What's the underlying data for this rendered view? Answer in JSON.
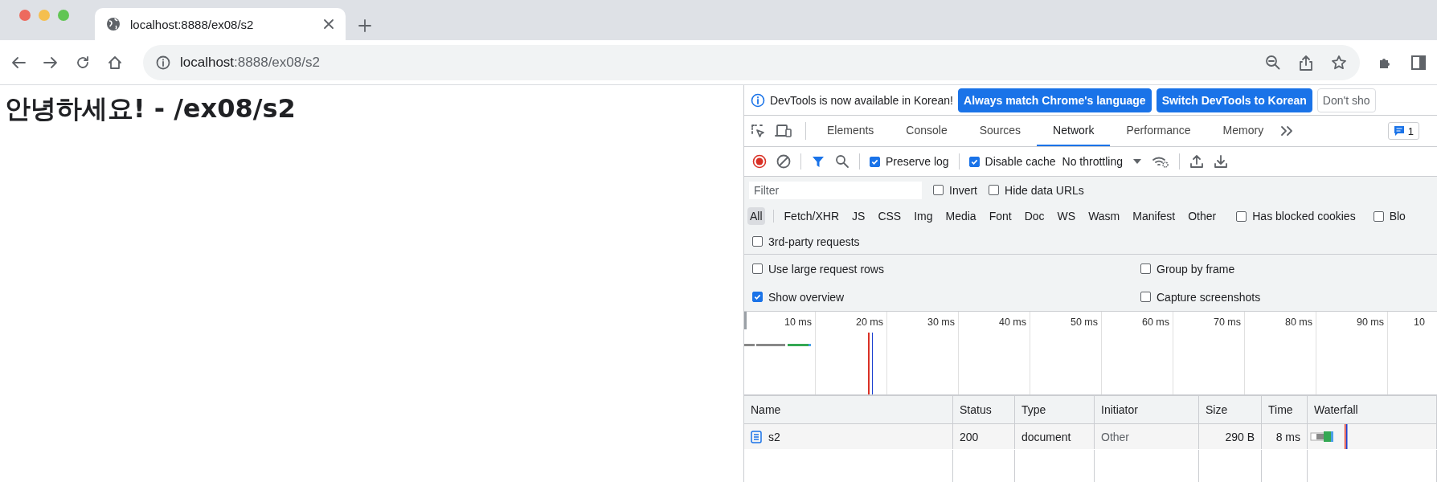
{
  "browser": {
    "tab": {
      "title": "localhost:8888/ex08/s2"
    },
    "address": {
      "host": "localhost",
      "path": ":8888/ex08/s2"
    }
  },
  "page": {
    "heading": "안녕하세요! - /ex08/s2"
  },
  "devtools": {
    "infobar": {
      "message": "DevTools is now available in Korean!",
      "buttons": [
        {
          "label": "Always match Chrome's language",
          "kind": "primary"
        },
        {
          "label": "Switch DevTools to Korean",
          "kind": "primary"
        },
        {
          "label": "Don't sho",
          "kind": "plain"
        }
      ]
    },
    "tabs": [
      {
        "label": "Elements",
        "selected": false
      },
      {
        "label": "Console",
        "selected": false
      },
      {
        "label": "Sources",
        "selected": false
      },
      {
        "label": "Network",
        "selected": true
      },
      {
        "label": "Performance",
        "selected": false
      },
      {
        "label": "Memory",
        "selected": false
      }
    ],
    "issues_badge": "1",
    "toolbar": {
      "checks": [
        {
          "label": "Preserve log",
          "checked": true
        },
        {
          "label": "Disable cache",
          "checked": true
        }
      ],
      "throttling": "No throttling"
    },
    "filter": {
      "placeholder": "Filter",
      "checks": [
        {
          "label": "Invert",
          "checked": false
        },
        {
          "label": "Hide data URLs",
          "checked": false
        }
      ]
    },
    "types": [
      {
        "label": "All",
        "selected": true
      },
      {
        "label": "Fetch/XHR",
        "selected": false
      },
      {
        "label": "JS",
        "selected": false
      },
      {
        "label": "CSS",
        "selected": false
      },
      {
        "label": "Img",
        "selected": false
      },
      {
        "label": "Media",
        "selected": false
      },
      {
        "label": "Font",
        "selected": false
      },
      {
        "label": "Doc",
        "selected": false
      },
      {
        "label": "WS",
        "selected": false
      },
      {
        "label": "Wasm",
        "selected": false
      },
      {
        "label": "Manifest",
        "selected": false
      },
      {
        "label": "Other",
        "selected": false
      }
    ],
    "type_checks": [
      {
        "label": "Has blocked cookies",
        "checked": false
      },
      {
        "label": "Blo",
        "checked": false
      }
    ],
    "third_party": {
      "label": "3rd-party requests",
      "checked": false
    },
    "settings": [
      {
        "label": "Use large request rows",
        "checked": false
      },
      {
        "label": "Group by frame",
        "checked": false
      },
      {
        "label": "Show overview",
        "checked": true
      },
      {
        "label": "Capture screenshots",
        "checked": false
      }
    ],
    "overview": {
      "ticks": [
        "10 ms",
        "20 ms",
        "30 ms",
        "40 ms",
        "50 ms",
        "60 ms",
        "70 ms",
        "80 ms",
        "90 ms",
        "10"
      ]
    },
    "table": {
      "columns": [
        "Name",
        "Status",
        "Type",
        "Initiator",
        "Size",
        "Time",
        "Waterfall"
      ],
      "rows": [
        {
          "cells": [
            "s2",
            "200",
            "document",
            "Other",
            "290 B",
            "8 ms"
          ]
        }
      ]
    }
  }
}
